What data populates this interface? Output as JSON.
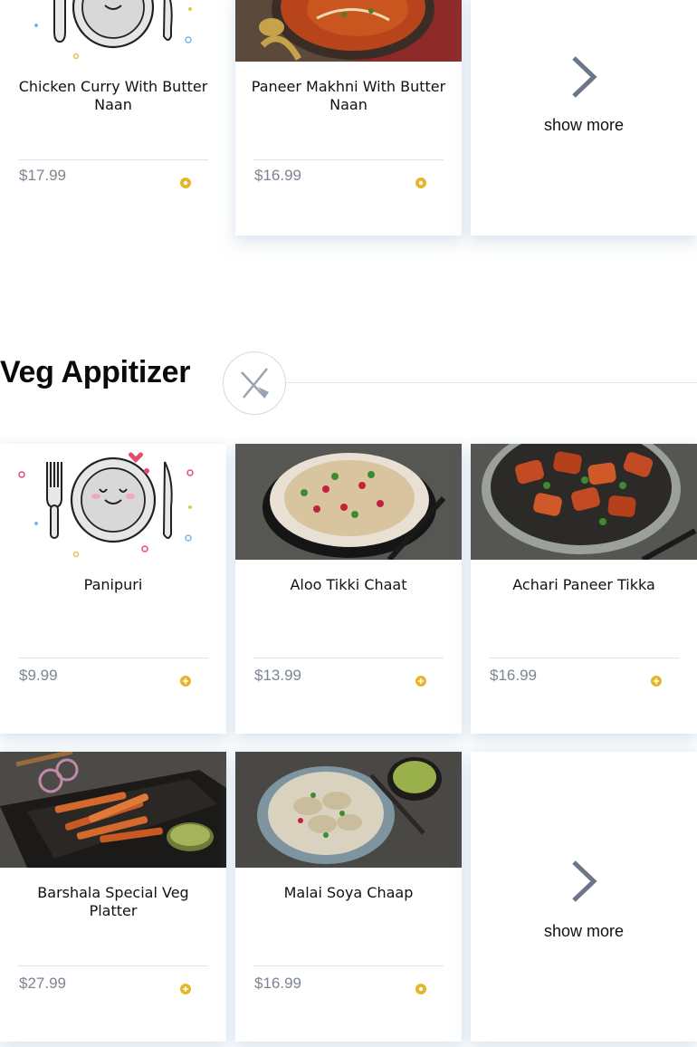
{
  "top_row": {
    "items": [
      {
        "name": "Chicken Curry With Butter Naan",
        "price": "$17.99",
        "image": "placeholder-plate"
      },
      {
        "name": "Paneer Makhni With Butter Naan",
        "price": "$16.99",
        "image": "paneer-makhni-photo"
      }
    ],
    "show_more": "show more"
  },
  "section": {
    "title": "Veg Appitizer",
    "icon": "fork-knife-icon"
  },
  "veg_items": [
    {
      "name": "Panipuri",
      "price": "$9.99",
      "image": "placeholder-plate"
    },
    {
      "name": "Aloo Tikki Chaat",
      "price": "$13.99",
      "image": "aloo-tikki-chaat-photo"
    },
    {
      "name": "Achari Paneer Tikka",
      "price": "$16.99",
      "image": "achari-paneer-tikka-photo"
    },
    {
      "name": "Barshala Special Veg Platter",
      "price": "$27.99",
      "image": "veg-platter-photo"
    },
    {
      "name": "Malai Soya Chaap",
      "price": "$16.99",
      "image": "malai-soya-chaap-photo"
    }
  ],
  "veg_show_more": "show more",
  "colors": {
    "accent": "#e5b62a",
    "price": "#7b8593",
    "chevron": "#6b7686"
  }
}
